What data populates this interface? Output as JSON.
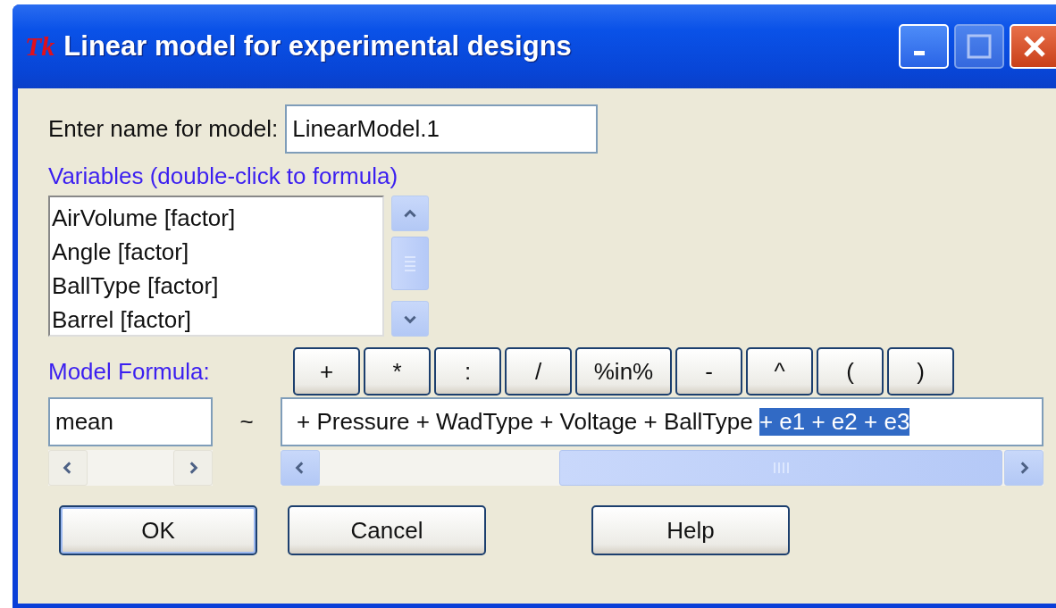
{
  "window": {
    "icon_text": "Tk",
    "title": "Linear model for experimental designs"
  },
  "model_name": {
    "label": "Enter name for model:",
    "value": "LinearModel.1"
  },
  "variables": {
    "label": "Variables (double-click to formula)",
    "items": [
      {
        "text": "AirVolume [factor]",
        "selected": false
      },
      {
        "text": "Angle [factor]",
        "selected": false
      },
      {
        "text": "BallType [factor]",
        "selected": false
      },
      {
        "text": "Barrel [factor]",
        "selected": false
      }
    ]
  },
  "formula": {
    "label": "Model Formula:",
    "operators": [
      "+",
      "*",
      ":",
      "/",
      "%in%",
      "-",
      "^",
      "(",
      ")"
    ],
    "response": "mean",
    "tilde": "~",
    "rhs_text": "+ Pressure + WadType + Voltage + BallType ",
    "rhs_selected_text": "+ e1 + e2 + e3"
  },
  "buttons": [
    {
      "label": "OK",
      "default": true
    },
    {
      "label": "Cancel",
      "default": false
    },
    {
      "label": "Help",
      "default": false
    }
  ]
}
